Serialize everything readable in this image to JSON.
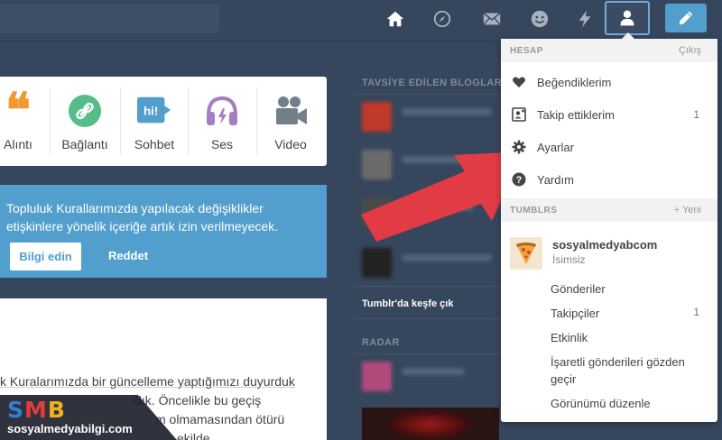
{
  "topbar": {
    "icons": [
      "home-icon",
      "explore-compass-icon",
      "inbox-mail-icon",
      "messaging-smile-icon",
      "activity-bolt-icon",
      "account-person-icon",
      "compose-pencil-icon"
    ]
  },
  "post_types": [
    {
      "label": "Alıntı",
      "icon": "quote-icon",
      "color": "#f2992e"
    },
    {
      "label": "Bağlantı",
      "icon": "link-icon",
      "color": "#56bc8a"
    },
    {
      "label": "Sohbet",
      "icon": "chat-icon",
      "color": "#529ecc"
    },
    {
      "label": "Ses",
      "icon": "audio-icon",
      "color": "#a77dc2"
    },
    {
      "label": "Video",
      "icon": "video-icon",
      "color": "#748089"
    }
  ],
  "notice": {
    "line1": "Topluluk Kurallarımızda yapılacak değişiklikler",
    "line2": "etişkinlere yönelik içeriğe artık izin verilmeyecek.",
    "learn_more": "Bilgi edin",
    "dismiss": "Reddet"
  },
  "post2": {
    "line1": "k Kuralarımızda bir güncelleme yaptığımızı duyurduk",
    "line2": "ldık. Öncelikle bu geçiş",
    "line3": "m olmamasından ötürü",
    "line4": "ekilde"
  },
  "sidebar": {
    "recommended_title": "TAVSİYE EDİLEN BLOGLAR",
    "explore_link": "Tumblr'da keşfe çık",
    "radar_title": "RADAR"
  },
  "dropdown": {
    "account_header": "HESAP",
    "logout": "Çıkış",
    "items": [
      {
        "label": "Beğendiklerim",
        "icon": "heart-icon",
        "count": ""
      },
      {
        "label": "Takip ettiklerim",
        "icon": "following-icon",
        "count": "1"
      },
      {
        "label": "Ayarlar",
        "icon": "settings-gear-icon",
        "count": ""
      },
      {
        "label": "Yardım",
        "icon": "help-icon",
        "count": ""
      }
    ],
    "tumblrs_header": "TUMBLRS",
    "new_blog": "+ Yeni",
    "blog": {
      "name": "sosyalmedyabcom",
      "title": "İsimsiz"
    },
    "blog_links": [
      {
        "label": "Gönderiler",
        "count": ""
      },
      {
        "label": "Takipçiler",
        "count": "1"
      },
      {
        "label": "Etkinlik",
        "count": ""
      },
      {
        "label": "İşaretli gönderileri gözden geçir",
        "count": ""
      },
      {
        "label": "Görünümü düzenle",
        "count": ""
      }
    ]
  },
  "watermark": {
    "logo_s": "S",
    "logo_m": "M",
    "logo_b": "B",
    "url": "sosyalmedyabilgi.com"
  }
}
